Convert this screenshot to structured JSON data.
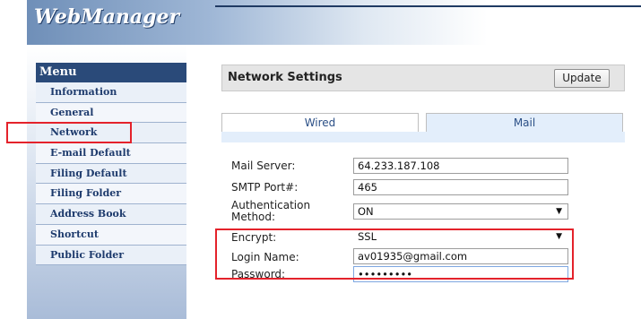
{
  "header": {
    "logo_text": "WebManager"
  },
  "sidebar": {
    "menu_title": "Menu",
    "items": [
      {
        "label": "Information"
      },
      {
        "label": "General"
      },
      {
        "label": "Network"
      },
      {
        "label": "E-mail Default"
      },
      {
        "label": "Filing Default"
      },
      {
        "label": "Filing Folder"
      },
      {
        "label": "Address Book"
      },
      {
        "label": "Shortcut"
      },
      {
        "label": "Public Folder"
      }
    ]
  },
  "panel": {
    "title": "Network Settings",
    "update_label": "Update",
    "tabs": [
      {
        "label": "Wired"
      },
      {
        "label": "Mail"
      }
    ]
  },
  "form": {
    "mail_server": {
      "label": "Mail Server:",
      "value": "64.233.187.108"
    },
    "smtp_port": {
      "label": "SMTP Port#:",
      "value": "465"
    },
    "auth_method": {
      "label_line1": "Authentication",
      "label_line2": "Method:",
      "value": "ON"
    },
    "encrypt": {
      "label": "Encrypt:",
      "value": "SSL"
    },
    "login_name": {
      "label": "Login Name:",
      "value": "av01935@gmail.com"
    },
    "password": {
      "label": "Password:",
      "value": "•••••••••"
    }
  },
  "colors": {
    "highlight": "#e4222b",
    "menu_header": "#2a4a79",
    "tab_active": "#e3eefb"
  }
}
